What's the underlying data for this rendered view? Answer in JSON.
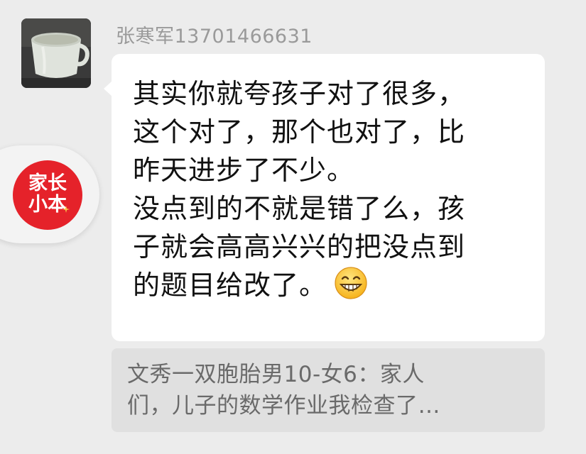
{
  "sender": {
    "name": "张寒军13701466631",
    "avatar_icon": "cup-photo-avatar"
  },
  "message": {
    "lines": [
      "其实你就夸孩子对了很多，",
      "这个对了，那个也对了，比",
      "昨天进步了不少。",
      "没点到的不就是错了么，孩",
      "子就会高高兴兴的把没点到",
      "的题目给改了。"
    ],
    "emoji": "grinning-face-emoji"
  },
  "quote": {
    "lines": [
      "文秀一双胞胎男10-女6：家人",
      "们，儿子的数学作业我检查了…"
    ]
  },
  "floating_button": {
    "logo_line1": "家长",
    "logo_line2": "小本",
    "logo_color": "#e5222a"
  }
}
